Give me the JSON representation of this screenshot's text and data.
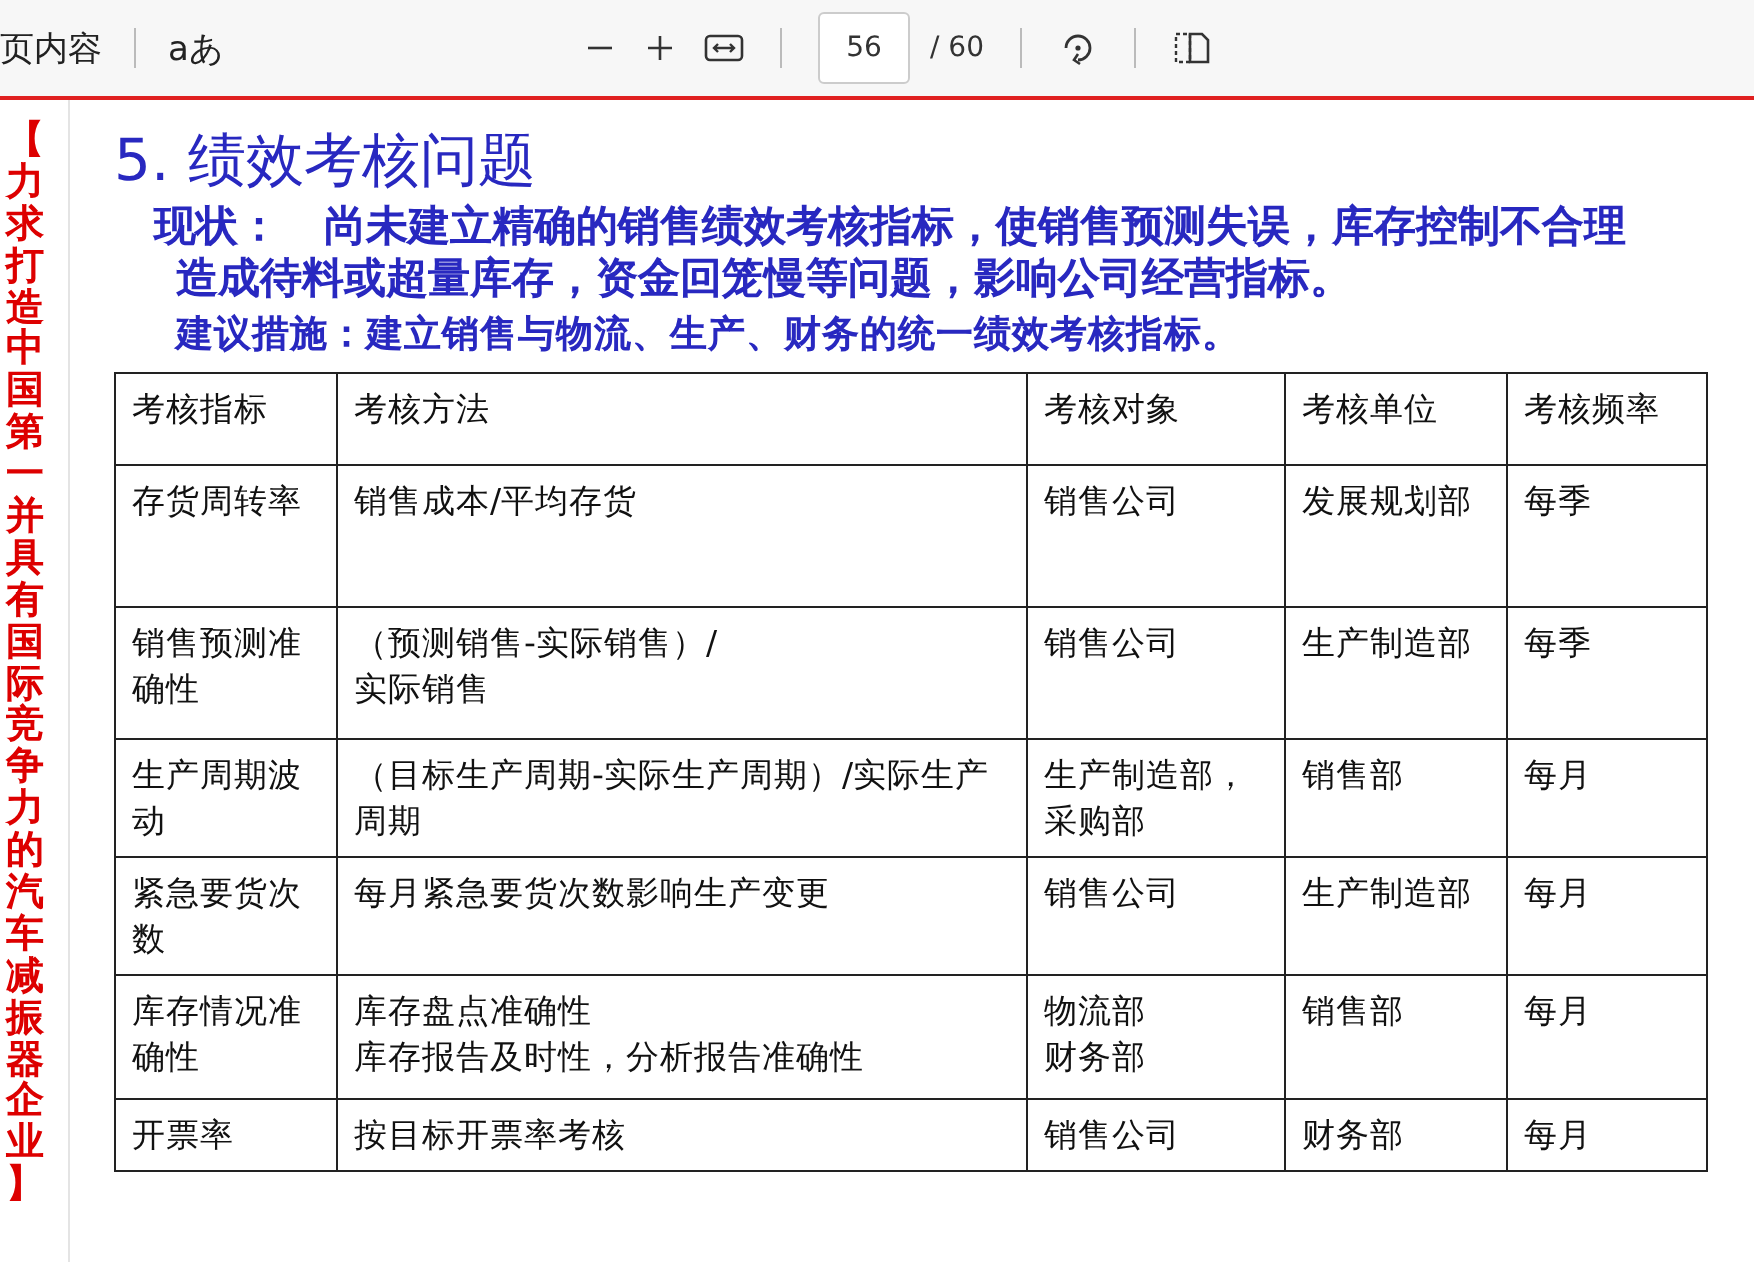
{
  "toolbar": {
    "contents_label": "页内容",
    "text_option": "aあ",
    "page_number": "56",
    "page_total": "/ 60"
  },
  "side_banner": "【力求打造中国第一并具有国际竞争力的汽车减振器企业】",
  "slide": {
    "title": "5.  绩效考核问题",
    "status_label": "现状：",
    "status_text": "尚未建立精确的销售绩效考核指标，使销售预测失误，库存控制不合理造成待料或超量库存，资金回笼慢等问题，影响公司经营指标。",
    "suggestion": "建议措施：建立销售与物流、生产、财务的统一绩效考核指标。",
    "table": {
      "columns": [
        "考核指标",
        "考核方法",
        "考核对象",
        "考核单位",
        "考核频率"
      ],
      "rows": [
        [
          [
            "存货周转率"
          ],
          [
            "销售成本/平均存货"
          ],
          [
            "销售公司"
          ],
          [
            "发展规划部"
          ],
          [
            "每季"
          ]
        ],
        [
          [
            "销售预测准确性"
          ],
          [
            "（预测销售-实际销售）/",
            "实际销售"
          ],
          [
            "销售公司"
          ],
          [
            "生产制造部"
          ],
          [
            "每季"
          ]
        ],
        [
          [
            "生产周期波动"
          ],
          [
            "（目标生产周期-实际生产周期）/实际生产周期"
          ],
          [
            "生产制造部，采购部"
          ],
          [
            "销售部"
          ],
          [
            "每月"
          ]
        ],
        [
          [
            "紧急要货次数"
          ],
          [
            "每月紧急要货次数影响生产变更"
          ],
          [
            "销售公司"
          ],
          [
            "生产制造部"
          ],
          [
            "每月"
          ]
        ],
        [
          [
            "库存情况准确性"
          ],
          [
            "库存盘点准确性",
            "库存报告及时性，分析报告准确性"
          ],
          [
            "物流部",
            "财务部"
          ],
          [
            "销售部"
          ],
          [
            "每月"
          ]
        ],
        [
          [
            "开票率"
          ],
          [
            "按目标开票率考核"
          ],
          [
            "销售公司"
          ],
          [
            "财务部"
          ],
          [
            "每月"
          ]
        ]
      ]
    }
  }
}
